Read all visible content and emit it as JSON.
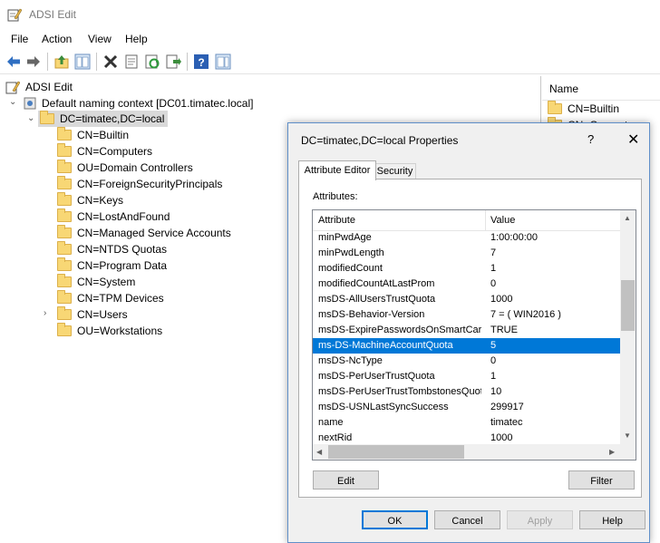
{
  "window": {
    "title": "ADSI Edit"
  },
  "menu": [
    "File",
    "Action",
    "View",
    "Help"
  ],
  "toolbar": {
    "icons": [
      "back-arrow-icon",
      "forward-arrow-icon",
      "up-folder-icon",
      "show-hide-tree-icon",
      "delete-icon",
      "properties-icon",
      "refresh-icon",
      "export-list-icon",
      "help-icon",
      "show-hide-action-pane-icon"
    ]
  },
  "tree": {
    "root": "ADSI Edit",
    "context": "Default naming context [DC01.timatec.local]",
    "domain": "DC=timatec,DC=local",
    "children": [
      "CN=Builtin",
      "CN=Computers",
      "OU=Domain Controllers",
      "CN=ForeignSecurityPrincipals",
      "CN=Keys",
      "CN=LostAndFound",
      "CN=Managed Service Accounts",
      "CN=NTDS Quotas",
      "CN=Program Data",
      "CN=System",
      "CN=TPM Devices",
      "CN=Users",
      "OU=Workstations"
    ]
  },
  "list": {
    "header": "Name",
    "items": [
      "CN=Builtin",
      "CN=Computers"
    ]
  },
  "dialog": {
    "title": "DC=timatec,DC=local Properties",
    "help": "?",
    "close": "✕",
    "tabs": [
      "Attribute Editor",
      "Security"
    ],
    "attributes_label": "Attributes:",
    "columns": [
      "Attribute",
      "Value"
    ],
    "rows": [
      {
        "attr": "minPwdAge",
        "value": "1:00:00:00"
      },
      {
        "attr": "minPwdLength",
        "value": "7"
      },
      {
        "attr": "modifiedCount",
        "value": "1"
      },
      {
        "attr": "modifiedCountAtLastProm",
        "value": "0"
      },
      {
        "attr": "msDS-AllUsersTrustQuota",
        "value": "1000"
      },
      {
        "attr": "msDS-Behavior-Version",
        "value": "7 = ( WIN2016 )"
      },
      {
        "attr": "msDS-ExpirePasswordsOnSmartCar...",
        "value": "TRUE"
      },
      {
        "attr": "ms-DS-MachineAccountQuota",
        "value": "5",
        "selected": true
      },
      {
        "attr": "msDS-NcType",
        "value": "0"
      },
      {
        "attr": "msDS-PerUserTrustQuota",
        "value": "1"
      },
      {
        "attr": "msDS-PerUserTrustTombstonesQuota",
        "value": "10"
      },
      {
        "attr": "msDS-USNLastSyncSuccess",
        "value": "299917"
      },
      {
        "attr": "name",
        "value": "timatec"
      },
      {
        "attr": "nextRid",
        "value": "1000"
      }
    ],
    "edit_label": "Edit",
    "filter_label": "Filter",
    "ok_label": "OK",
    "cancel_label": "Cancel",
    "apply_label": "Apply",
    "help_label": "Help"
  },
  "colors": {
    "selection": "#0078d7",
    "folder": "#f8d775",
    "dialog_bg": "#f0f0f0"
  }
}
